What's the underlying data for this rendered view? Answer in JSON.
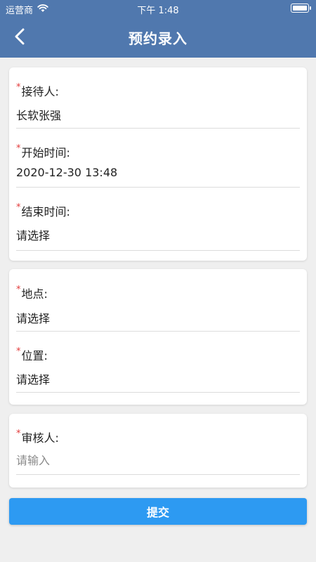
{
  "status_bar": {
    "carrier": "运营商",
    "time": "下午 1:48",
    "wifi_icon": "wifi-icon",
    "battery_icon": "battery-icon"
  },
  "nav": {
    "title": "预约录入",
    "back_icon": "chevron-left-icon"
  },
  "form": {
    "required_mark": "*",
    "receptionist": {
      "label": "接待人:",
      "value": "长软张强"
    },
    "start_time": {
      "label": "开始时间:",
      "value": "2020-12-30 13:48"
    },
    "end_time": {
      "label": "结束时间:",
      "value": "请选择"
    },
    "location": {
      "label": "地点:",
      "value": "请选择"
    },
    "position": {
      "label": "位置:",
      "value": "请选择"
    },
    "reviewer": {
      "label": "审核人:",
      "value": "",
      "placeholder": "请输入"
    }
  },
  "submit": {
    "label": "提交"
  },
  "colors": {
    "header_bg": "#5078ae",
    "page_bg": "#efefef",
    "required": "#e23b3b",
    "submit_bg": "#2d9af2"
  }
}
